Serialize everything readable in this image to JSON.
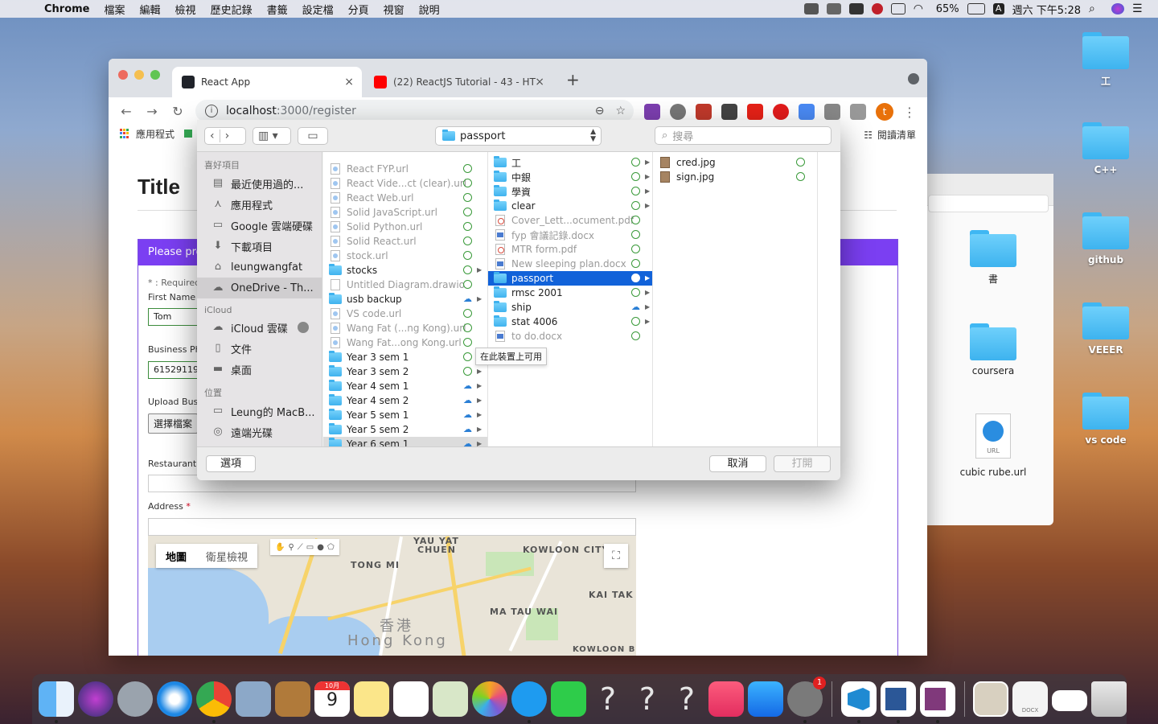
{
  "menubar": {
    "app": "Chrome",
    "items": [
      "檔案",
      "編輯",
      "檢視",
      "歷史記錄",
      "書籤",
      "設定檔",
      "分頁",
      "視窗",
      "說明"
    ],
    "battery": "65%",
    "input_source": "A",
    "clock": "週六 下午5:28"
  },
  "desktop": {
    "items": [
      {
        "label": "工"
      },
      {
        "label": "C++"
      },
      {
        "label": "github"
      },
      {
        "label": "VEEER"
      },
      {
        "label": "vs code"
      }
    ],
    "finder_items": [
      {
        "label": "書"
      },
      {
        "label": "coursera"
      },
      {
        "label": "cubic rube.url"
      }
    ],
    "url_icon_label": "URL"
  },
  "browser": {
    "tabs": [
      {
        "title": "React App",
        "active": true
      },
      {
        "title": "(22) ReactJS Tutorial - 43 - HT",
        "active": false
      }
    ],
    "url_host": "localhost",
    "url_path": ":3000/register",
    "profile_initial": "t",
    "bookmarks": {
      "apps": "應用程式",
      "reading_list": "閱讀清單"
    }
  },
  "page": {
    "title": "Title",
    "form_header": "Please prov",
    "required_note": "* : Required",
    "first_name_label": "First Name",
    "first_name_value": "Tom",
    "business_phone_label": "Business Pho",
    "business_phone_value": "61529119",
    "upload_label": "Upload Busin",
    "choose_file": "選擇檔案",
    "restaurant_label": "Restaurant N",
    "address_label": "Address",
    "required_mark": "*"
  },
  "map": {
    "tab_map": "地圖",
    "tab_satellite": "衛星檢視",
    "labels": [
      "YAU YAT",
      "CHUEN",
      "KOWLOON CITY",
      "TONG MI",
      "KAI TAK",
      "MA TAU WAI",
      "香港",
      "Hong Kong",
      "KOWLOON B"
    ]
  },
  "dialog": {
    "location": "passport",
    "search_placeholder": "搜尋",
    "sidebar": {
      "favorites_header": "喜好項目",
      "favorites": [
        "最近使用過的...",
        "應用程式",
        "Google 雲端硬碟",
        "下載項目",
        "leungwangfat",
        "OneDrive - Th..."
      ],
      "icloud_header": "iCloud",
      "icloud": [
        "iCloud 雲碟",
        "文件",
        "桌面"
      ],
      "locations_header": "位置",
      "locations": [
        "Leung的 MacB...",
        "遠端光碟"
      ]
    },
    "col1": [
      {
        "name": "React FYP.url",
        "kind": "url",
        "dim": true,
        "status": "check"
      },
      {
        "name": "React Vide...ct (clear).url",
        "kind": "url",
        "dim": true,
        "status": "check"
      },
      {
        "name": "React Web.url",
        "kind": "url",
        "dim": true,
        "status": "check"
      },
      {
        "name": "Solid JavaScript.url",
        "kind": "url",
        "dim": true,
        "status": "check"
      },
      {
        "name": "Solid Python.url",
        "kind": "url",
        "dim": true,
        "status": "check"
      },
      {
        "name": "Solid React.url",
        "kind": "url",
        "dim": true,
        "status": "check"
      },
      {
        "name": "stock.url",
        "kind": "url",
        "dim": true,
        "status": "check"
      },
      {
        "name": "stocks",
        "kind": "folder",
        "dim": false,
        "status": "check",
        "chev": true
      },
      {
        "name": "Untitled Diagram.drawio",
        "kind": "file",
        "dim": true,
        "status": "check"
      },
      {
        "name": "usb backup",
        "kind": "folder",
        "dim": false,
        "status": "cloud",
        "chev": true
      },
      {
        "name": "VS code.url",
        "kind": "url",
        "dim": true,
        "status": "check"
      },
      {
        "name": "Wang Fat (...ng Kong).url",
        "kind": "url",
        "dim": true,
        "status": "check"
      },
      {
        "name": "Wang Fat...ong Kong.url",
        "kind": "url",
        "dim": true,
        "status": "check"
      },
      {
        "name": "Year 3 sem 1",
        "kind": "folder",
        "dim": false,
        "status": "check",
        "chev": false
      },
      {
        "name": "Year 3 sem 2",
        "kind": "folder",
        "dim": false,
        "status": "check",
        "chev": true
      },
      {
        "name": "Year 4 sem 1",
        "kind": "folder",
        "dim": false,
        "status": "cloud",
        "chev": true
      },
      {
        "name": "Year 4 sem 2",
        "kind": "folder",
        "dim": false,
        "status": "cloud",
        "chev": true
      },
      {
        "name": "Year 5 sem 1",
        "kind": "folder",
        "dim": false,
        "status": "cloud",
        "chev": true
      },
      {
        "name": "Year 5 sem 2",
        "kind": "folder",
        "dim": false,
        "status": "cloud",
        "chev": true
      },
      {
        "name": "Year 6 sem 1",
        "kind": "folder",
        "dim": false,
        "status": "cloud",
        "chev": true,
        "hover": true
      }
    ],
    "col2": [
      {
        "name": "工",
        "kind": "folder",
        "dim": false,
        "status": "check",
        "chev": true
      },
      {
        "name": "中銀",
        "kind": "folder",
        "dim": false,
        "status": "check",
        "chev": true
      },
      {
        "name": "學資",
        "kind": "folder",
        "dim": false,
        "status": "check",
        "chev": true
      },
      {
        "name": "clear",
        "kind": "folder",
        "dim": false,
        "status": "check",
        "chev": true
      },
      {
        "name": "Cover_Lett...ocument.pdf",
        "kind": "pdf",
        "dim": true,
        "status": "check"
      },
      {
        "name": "fyp 會議記錄.docx",
        "kind": "word",
        "dim": true,
        "status": "check"
      },
      {
        "name": "MTR form.pdf",
        "kind": "pdf",
        "dim": true,
        "status": "check"
      },
      {
        "name": "New sleeping plan.docx",
        "kind": "word",
        "dim": true,
        "status": "check"
      },
      {
        "name": "passport",
        "kind": "folder",
        "dim": false,
        "status": "check",
        "chev": true,
        "selected": true
      },
      {
        "name": "rmsc 2001",
        "kind": "folder",
        "dim": false,
        "status": "check",
        "chev": true
      },
      {
        "name": "ship",
        "kind": "folder",
        "dim": false,
        "status": "cloud",
        "chev": true
      },
      {
        "name": "stat 4006",
        "kind": "folder",
        "dim": false,
        "status": "check",
        "chev": true
      },
      {
        "name": "to do.docx",
        "kind": "word",
        "dim": true,
        "status": "check"
      }
    ],
    "col3": [
      {
        "name": "cred.jpg",
        "kind": "img",
        "dim": false,
        "status": "check"
      },
      {
        "name": "sign.jpg",
        "kind": "img",
        "dim": false,
        "status": "check"
      }
    ],
    "tooltip": "在此裝置上可用",
    "options_button": "選項",
    "cancel_button": "取消",
    "open_button": "打開"
  },
  "dock": {
    "calendar_month": "10月",
    "calendar_day": "9",
    "badge": "1",
    "doc_label": "DOCX"
  }
}
